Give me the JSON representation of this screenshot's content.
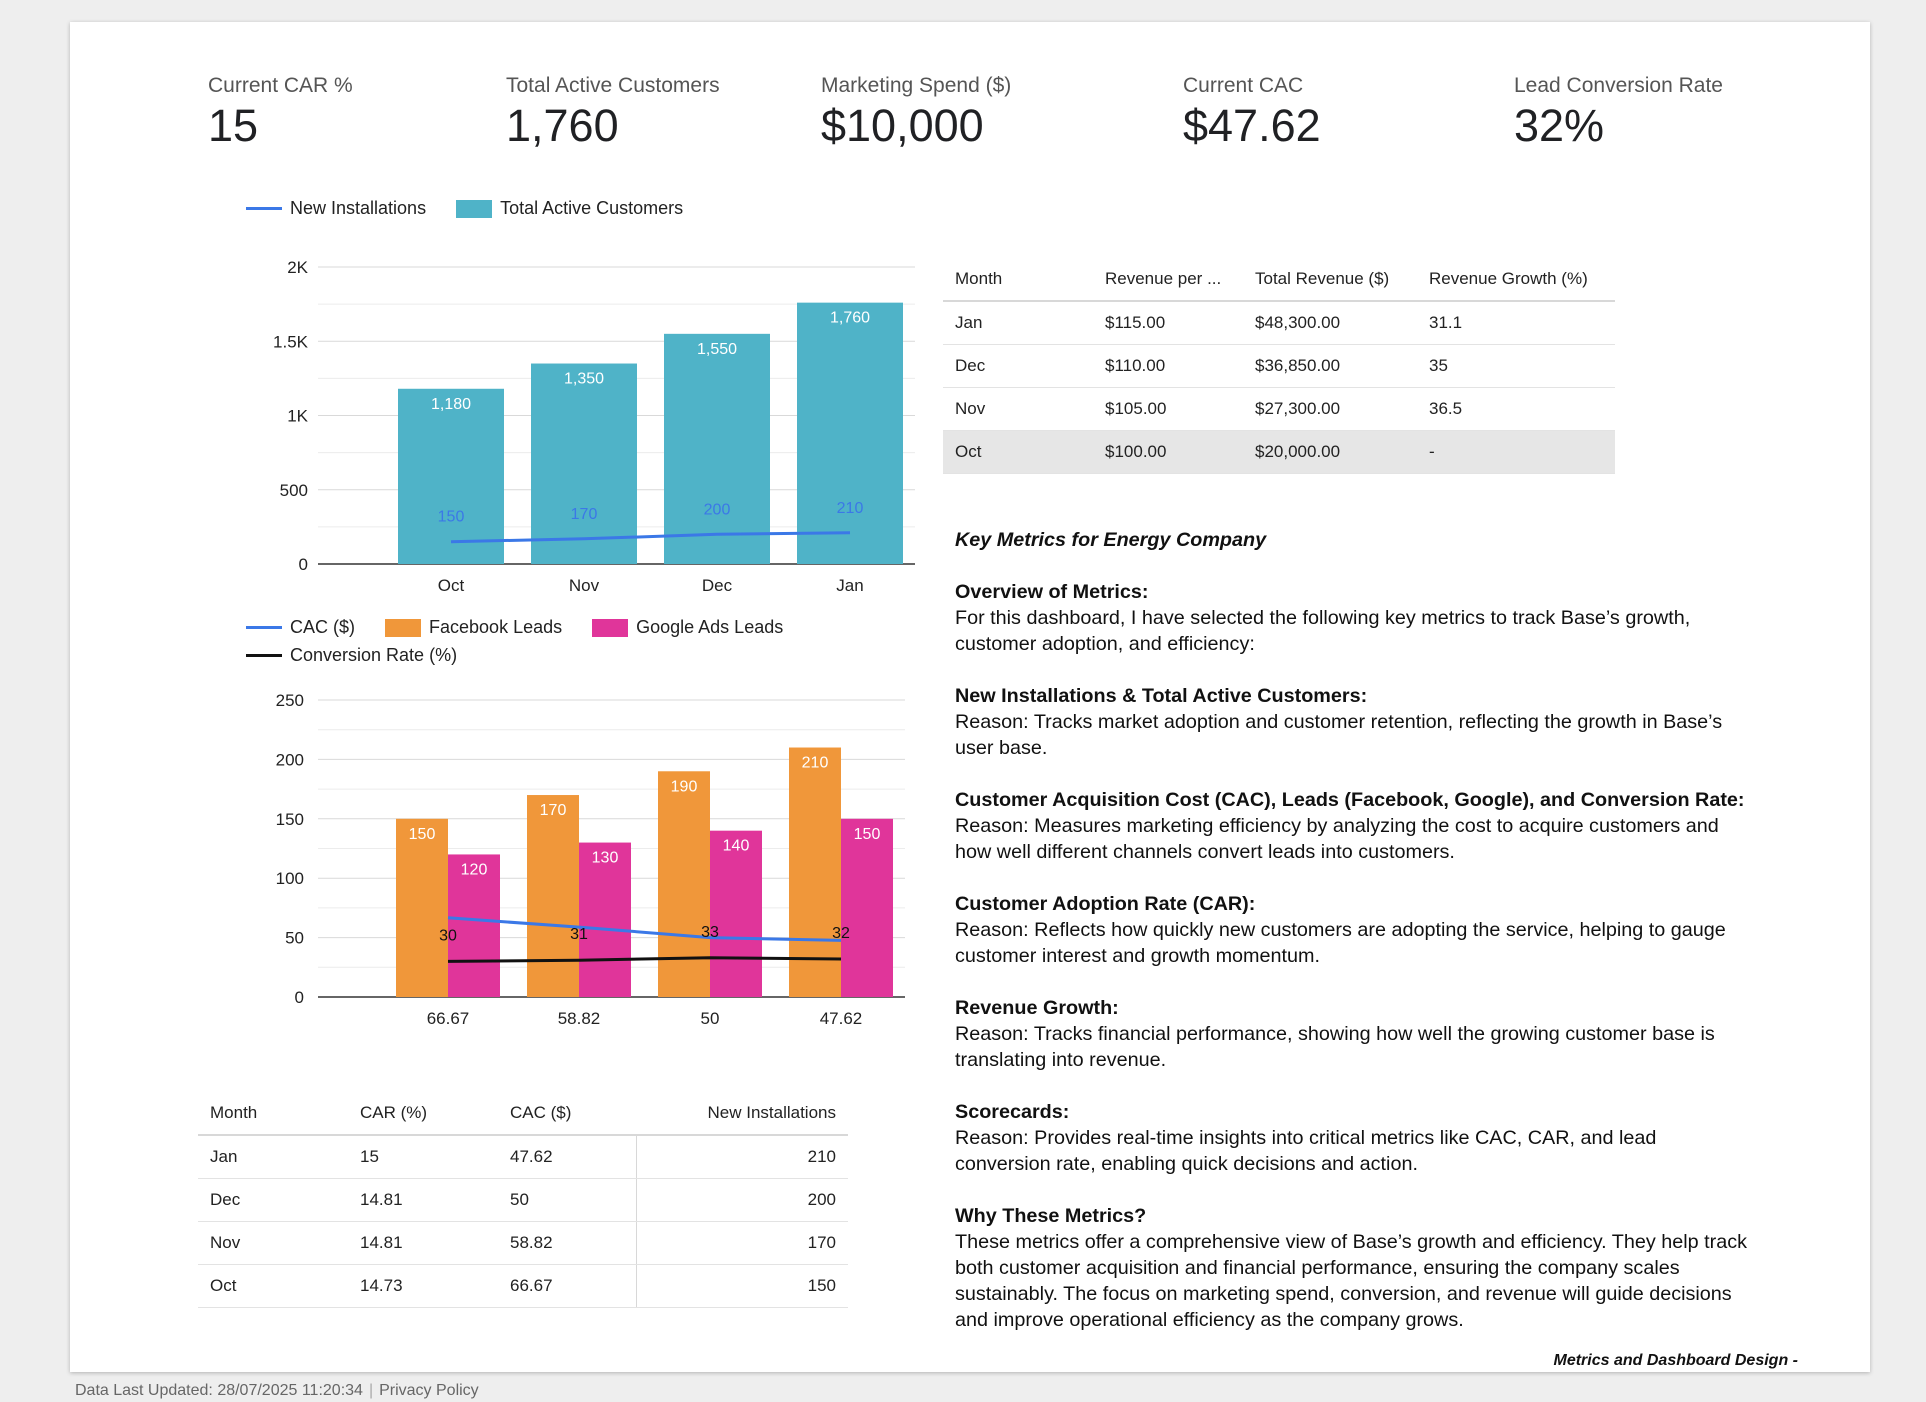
{
  "scorecards": [
    {
      "label": "Current CAR %",
      "value": "15"
    },
    {
      "label": "Total Active Customers",
      "value": "1,760"
    },
    {
      "label": "Marketing Spend ($)",
      "value": "$10,000"
    },
    {
      "label": "Current CAC",
      "value": "$47.62"
    },
    {
      "label": "Lead Conversion Rate",
      "value": "32%"
    }
  ],
  "chart_data": [
    {
      "type": "bar",
      "categories": [
        "Oct",
        "Nov",
        "Dec",
        "Jan"
      ],
      "series": [
        {
          "name": "Total Active Customers",
          "kind": "bar",
          "color": "#4fb3c8",
          "values": [
            1180,
            1350,
            1550,
            1760
          ],
          "labels": [
            "1,180",
            "1,350",
            "1,550",
            "1,760"
          ]
        },
        {
          "name": "New Installations",
          "kind": "line",
          "color": "#3b78e7",
          "values": [
            150,
            170,
            200,
            210
          ],
          "labels": [
            "150",
            "170",
            "200",
            "210"
          ]
        }
      ],
      "ylim": [
        0,
        2000
      ],
      "yticks": [
        "0",
        "500",
        "1K",
        "1.5K",
        "2K"
      ],
      "legend": "top-left",
      "grid": true
    },
    {
      "type": "bar",
      "categories": [
        "66.67",
        "58.82",
        "50",
        "47.62"
      ],
      "series": [
        {
          "name": "Facebook Leads",
          "kind": "bar",
          "color": "#f0973a",
          "values": [
            150,
            170,
            190,
            210
          ]
        },
        {
          "name": "Google Ads Leads",
          "kind": "bar",
          "color": "#e0359a",
          "values": [
            120,
            130,
            140,
            150
          ]
        },
        {
          "name": "CAC ($)",
          "kind": "line",
          "color": "#3b78e7",
          "values": [
            66.67,
            58.82,
            50,
            47.62
          ]
        },
        {
          "name": "Conversion Rate (%)",
          "kind": "line",
          "color": "#111111",
          "values": [
            30,
            31,
            33,
            32
          ]
        }
      ],
      "ylim": [
        0,
        250
      ],
      "yticks": [
        "0",
        "50",
        "100",
        "150",
        "200",
        "250"
      ],
      "legend": "top-left",
      "grid": true
    }
  ],
  "revenue_table": {
    "headers": [
      "Month",
      "Revenue per ...",
      "Total Revenue ($)",
      "Revenue Growth (%)"
    ],
    "rows": [
      [
        "Jan",
        "$115.00",
        "$48,300.00",
        "31.1"
      ],
      [
        "Dec",
        "$110.00",
        "$36,850.00",
        "35"
      ],
      [
        "Nov",
        "$105.00",
        "$27,300.00",
        "36.5"
      ],
      [
        "Oct",
        "$100.00",
        "$20,000.00",
        "-"
      ]
    ]
  },
  "metrics_table": {
    "headers": [
      "Month",
      "CAR (%)",
      "CAC ($)",
      "New Installations"
    ],
    "rows": [
      [
        "Jan",
        "15",
        "47.62",
        "210"
      ],
      [
        "Dec",
        "14.81",
        "50",
        "200"
      ],
      [
        "Nov",
        "14.81",
        "58.82",
        "170"
      ],
      [
        "Oct",
        "14.73",
        "66.67",
        "150"
      ]
    ]
  },
  "notes": {
    "title": "Key Metrics for Energy Company",
    "sections": [
      {
        "heading": "Overview of Metrics:",
        "body": "For this dashboard, I have selected the following key metrics to track Base’s growth, customer adoption, and efficiency:"
      },
      {
        "heading": "New Installations & Total Active Customers:",
        "body": "Reason: Tracks market adoption and customer retention, reflecting the growth in Base’s user base."
      },
      {
        "heading": "Customer Acquisition Cost (CAC), Leads (Facebook, Google), and Conversion Rate:",
        "body": "Reason: Measures marketing efficiency by analyzing the cost to acquire customers and how well different channels convert leads into customers."
      },
      {
        "heading": "Customer Adoption Rate (CAR):",
        "body": "Reason: Reflects how quickly new customers are adopting the service, helping to gauge customer interest and growth momentum."
      },
      {
        "heading": "Revenue Growth:",
        "body": "Reason: Tracks financial performance, showing how well the growing customer base is translating into revenue."
      },
      {
        "heading": "Scorecards:",
        "body": "Reason: Provides real-time insights into critical metrics like CAC, CAR, and lead conversion rate, enabling quick decisions and action."
      },
      {
        "heading": "Why These Metrics?",
        "body": "These metrics offer a comprehensive view of Base’s growth and efficiency. They help track both customer acquisition and financial performance, ensuring the company scales sustainably. The focus on marketing spend, conversion, and revenue will guide decisions and improve operational efficiency as the company grows."
      }
    ]
  },
  "signature": "Metrics and Dashboard Design -",
  "footer": {
    "updated": "Data Last Updated: 28/07/2025 11:20:34",
    "privacy": "Privacy Policy"
  }
}
